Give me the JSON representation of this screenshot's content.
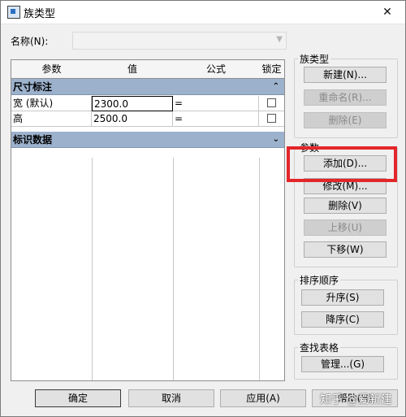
{
  "window": {
    "title": "族类型",
    "close": "✕"
  },
  "name_field": {
    "label": "名称(N):",
    "value": ""
  },
  "table": {
    "columns": [
      "参数",
      "值",
      "公式",
      "锁定"
    ],
    "groups": [
      {
        "title": "尺寸标注",
        "chevron": "⌃",
        "rows": [
          {
            "param": "宽 (默认)",
            "value": "2300.0",
            "formula": "="
          },
          {
            "param": "高",
            "value": "2500.0",
            "formula": "="
          }
        ]
      },
      {
        "title": "标识数据",
        "chevron": "⌄",
        "rows": []
      }
    ]
  },
  "family_types": {
    "label": "族类型",
    "new": "新建(N)...",
    "rename": "重命名(R)...",
    "delete": "删除(E)"
  },
  "parameters": {
    "label": "参数",
    "add": "添加(D)...",
    "modify": "修改(M)...",
    "delete": "删除(V)",
    "move_up": "上移(U)",
    "move_down": "下移(W)"
  },
  "sort_order": {
    "label": "排序顺序",
    "ascending": "升序(S)",
    "descending": "降序(C)"
  },
  "lookup_tables": {
    "label": "查找表格",
    "manage": "管理...(G)"
  },
  "footer": {
    "ok": "确定",
    "cancel": "取消",
    "apply": "应用(A)",
    "help": "帮助(H)"
  },
  "watermark": "知乎 @爱新建",
  "colors": {
    "highlight": "#e3262a",
    "group_header": "#9cb1cc"
  }
}
